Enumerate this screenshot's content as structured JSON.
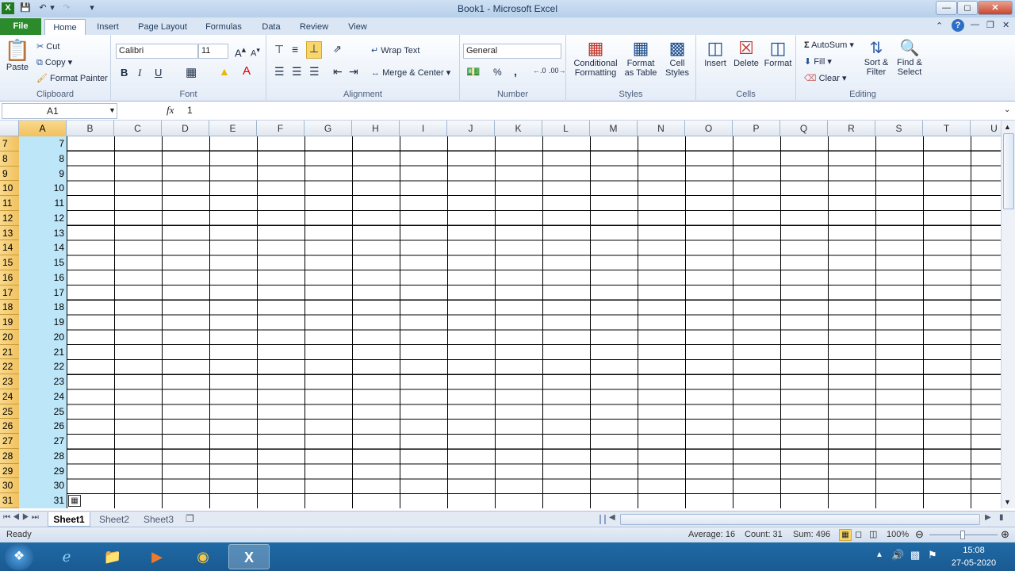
{
  "window": {
    "title": "Book1  -  Microsoft Excel"
  },
  "tabs": [
    "File",
    "Home",
    "Insert",
    "Page Layout",
    "Formulas",
    "Data",
    "Review",
    "View"
  ],
  "clipboard": {
    "paste": "Paste",
    "cut": "Cut",
    "copy": "Copy",
    "format_painter": "Format Painter",
    "label": "Clipboard"
  },
  "font": {
    "name": "Calibri",
    "size": "11",
    "bold": "B",
    "italic": "I",
    "underline": "U",
    "label": "Font"
  },
  "alignment": {
    "wrap_text": "Wrap Text",
    "merge_center": "Merge & Center",
    "label": "Alignment"
  },
  "number": {
    "format": "General",
    "percent": "%",
    "comma": ",",
    "label": "Number"
  },
  "styles": {
    "conditional_formatting": "Conditional Formatting",
    "format_as_table": "Format as Table",
    "cell_styles": "Cell Styles",
    "label": "Styles"
  },
  "cells": {
    "insert": "Insert",
    "delete": "Delete",
    "format": "Format",
    "label": "Cells"
  },
  "editing": {
    "autosum": "AutoSum",
    "fill": "Fill",
    "clear": "Clear",
    "sort_filter": "Sort & Filter",
    "find_select": "Find & Select",
    "label": "Editing"
  },
  "formula_bar": {
    "name_box": "A1",
    "fx": "fx",
    "value": "1"
  },
  "grid": {
    "columns": [
      "A",
      "B",
      "C",
      "D",
      "E",
      "F",
      "G",
      "H",
      "I",
      "J",
      "K",
      "L",
      "M",
      "N",
      "O",
      "P",
      "Q",
      "R",
      "S",
      "T",
      "U"
    ],
    "selected_column": "A",
    "row_numbers": [
      "7",
      "8",
      "9",
      "10",
      "11",
      "12",
      "13",
      "14",
      "15",
      "16",
      "17",
      "18",
      "19",
      "20",
      "21",
      "22",
      "23",
      "24",
      "25",
      "26",
      "27",
      "28",
      "29",
      "30",
      "31"
    ],
    "column_a_values": [
      "7",
      "8",
      "9",
      "10",
      "11",
      "12",
      "13",
      "14",
      "15",
      "16",
      "17",
      "18",
      "19",
      "20",
      "21",
      "22",
      "23",
      "24",
      "25",
      "26",
      "27",
      "28",
      "29",
      "30",
      "31"
    ]
  },
  "sheets": [
    "Sheet1",
    "Sheet2",
    "Sheet3"
  ],
  "active_sheet": "Sheet1",
  "status": {
    "mode": "Ready",
    "average": "Average: 16",
    "count": "Count: 31",
    "sum": "Sum: 496",
    "zoom": "100%"
  },
  "taskbar": {
    "time": "15:08",
    "date": "27-05-2020"
  },
  "colors": {
    "selection": "#bde6f9",
    "header_selected": "#f1c15f",
    "file_tab": "#2b8a2b",
    "taskbar": "#1a5a92"
  }
}
